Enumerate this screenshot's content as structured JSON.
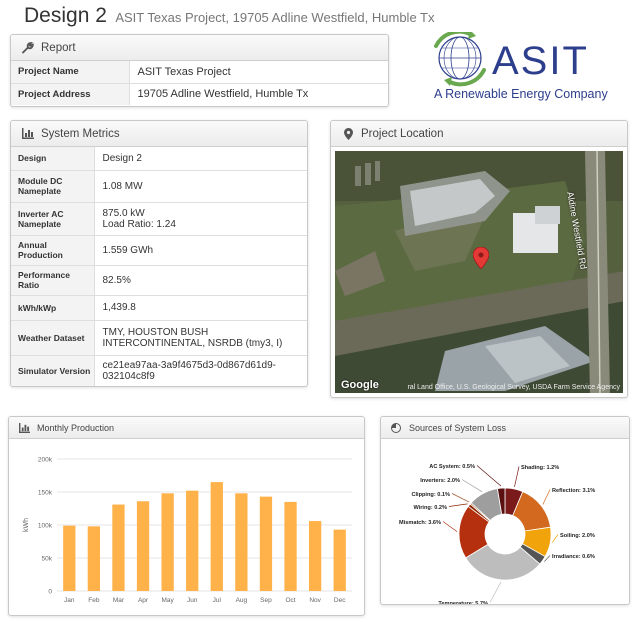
{
  "header": {
    "title": "Design 2",
    "subtitle": "ASIT Texas Project, 19705 Adline Westfield, Humble Tx"
  },
  "report": {
    "title": "Report",
    "icon": "wrench-icon",
    "rows": [
      {
        "label": "Project Name",
        "value": "ASIT Texas Project"
      },
      {
        "label": "Project Address",
        "value": "19705 Adline Westfield, Humble Tx"
      }
    ]
  },
  "logo": {
    "name": "ASIT",
    "tagline": "A Renewable Energy Company",
    "colors": {
      "blue": "#2c3e8c",
      "green": "#6aa84f"
    }
  },
  "metrics": {
    "title": "System Metrics",
    "icon": "bar-chart-icon",
    "rows": [
      {
        "label": "Design",
        "value": "Design 2"
      },
      {
        "label": "Module DC Nameplate",
        "value": "1.08 MW"
      },
      {
        "label": "Inverter AC Nameplate",
        "value": "875.0 kW",
        "value2": "Load Ratio: 1.24"
      },
      {
        "label": "Annual Production",
        "value": "1.559 GWh"
      },
      {
        "label": "Performance Ratio",
        "value": "82.5%"
      },
      {
        "label": "kWh/kWp",
        "value": "1,439.8"
      },
      {
        "label": "Weather Dataset",
        "value": "TMY, HOUSTON BUSH",
        "value2": "INTERCONTINENTAL, NSRDB (tmy3, I)"
      },
      {
        "label": "Simulator Version",
        "value": "ce21ea97aa-3a9f4675d3-0d867d61d9-",
        "value2": "032104c8f9"
      }
    ]
  },
  "location": {
    "title": "Project Location",
    "icon": "map-marker-icon",
    "road_label": "Aldine Westfield Rd",
    "google": "Google",
    "attribution": "ral Land Office, U.S. Geological Survey, USDA Farm Service Agency"
  },
  "monthly": {
    "title": "Monthly Production",
    "icon": "bar-chart-icon"
  },
  "losses": {
    "title": "Sources of System Loss",
    "icon": "pie-chart-icon"
  },
  "chart_data": [
    {
      "type": "bar",
      "categories": [
        "Jan",
        "Feb",
        "Mar",
        "Apr",
        "May",
        "Jun",
        "Jul",
        "Aug",
        "Sep",
        "Oct",
        "Nov",
        "Dec"
      ],
      "values": [
        99000,
        98000,
        131000,
        136000,
        148000,
        152000,
        165000,
        148000,
        143000,
        135000,
        106000,
        93000
      ],
      "ylabel": "kWh",
      "ylim": [
        0,
        200000
      ],
      "yticks": [
        0,
        50000,
        100000,
        150000,
        200000
      ],
      "ytick_labels": [
        "0",
        "50k",
        "100k",
        "150k",
        "200k"
      ],
      "grid": true,
      "color": "#ffb24a"
    },
    {
      "type": "pie",
      "style": "donut",
      "slices": [
        {
          "name": "Shading",
          "value": 1.2,
          "label": "Shading: 1.2%",
          "color": "#7a1a1a"
        },
        {
          "name": "Reflection",
          "value": 3.1,
          "label": "Reflection: 3.1%",
          "color": "#d2691e"
        },
        {
          "name": "Soiling",
          "value": 2.0,
          "label": "Soiling: 2.0%",
          "color": "#f0a30a"
        },
        {
          "name": "Irradiance",
          "value": 0.6,
          "label": "Irradiance: 0.6%",
          "color": "#555555"
        },
        {
          "name": "Temperature",
          "value": 5.7,
          "label": "Temperature: 5.7%",
          "color": "#bdbdbd"
        },
        {
          "name": "Mismatch",
          "value": 3.6,
          "label": "Mismatch: 3.6%",
          "color": "#b5300f"
        },
        {
          "name": "Wiring",
          "value": 0.2,
          "label": "Wiring: 0.2%",
          "color": "#8b2500"
        },
        {
          "name": "Clipping",
          "value": 0.1,
          "label": "Clipping: 0.1%",
          "color": "#a0522d"
        },
        {
          "name": "Inverters",
          "value": 2.0,
          "label": "Inverters: 2.0%",
          "color": "#9e9e9e"
        },
        {
          "name": "AC System",
          "value": 0.5,
          "label": "AC System: 0.5%",
          "color": "#5a1010"
        }
      ]
    }
  ]
}
